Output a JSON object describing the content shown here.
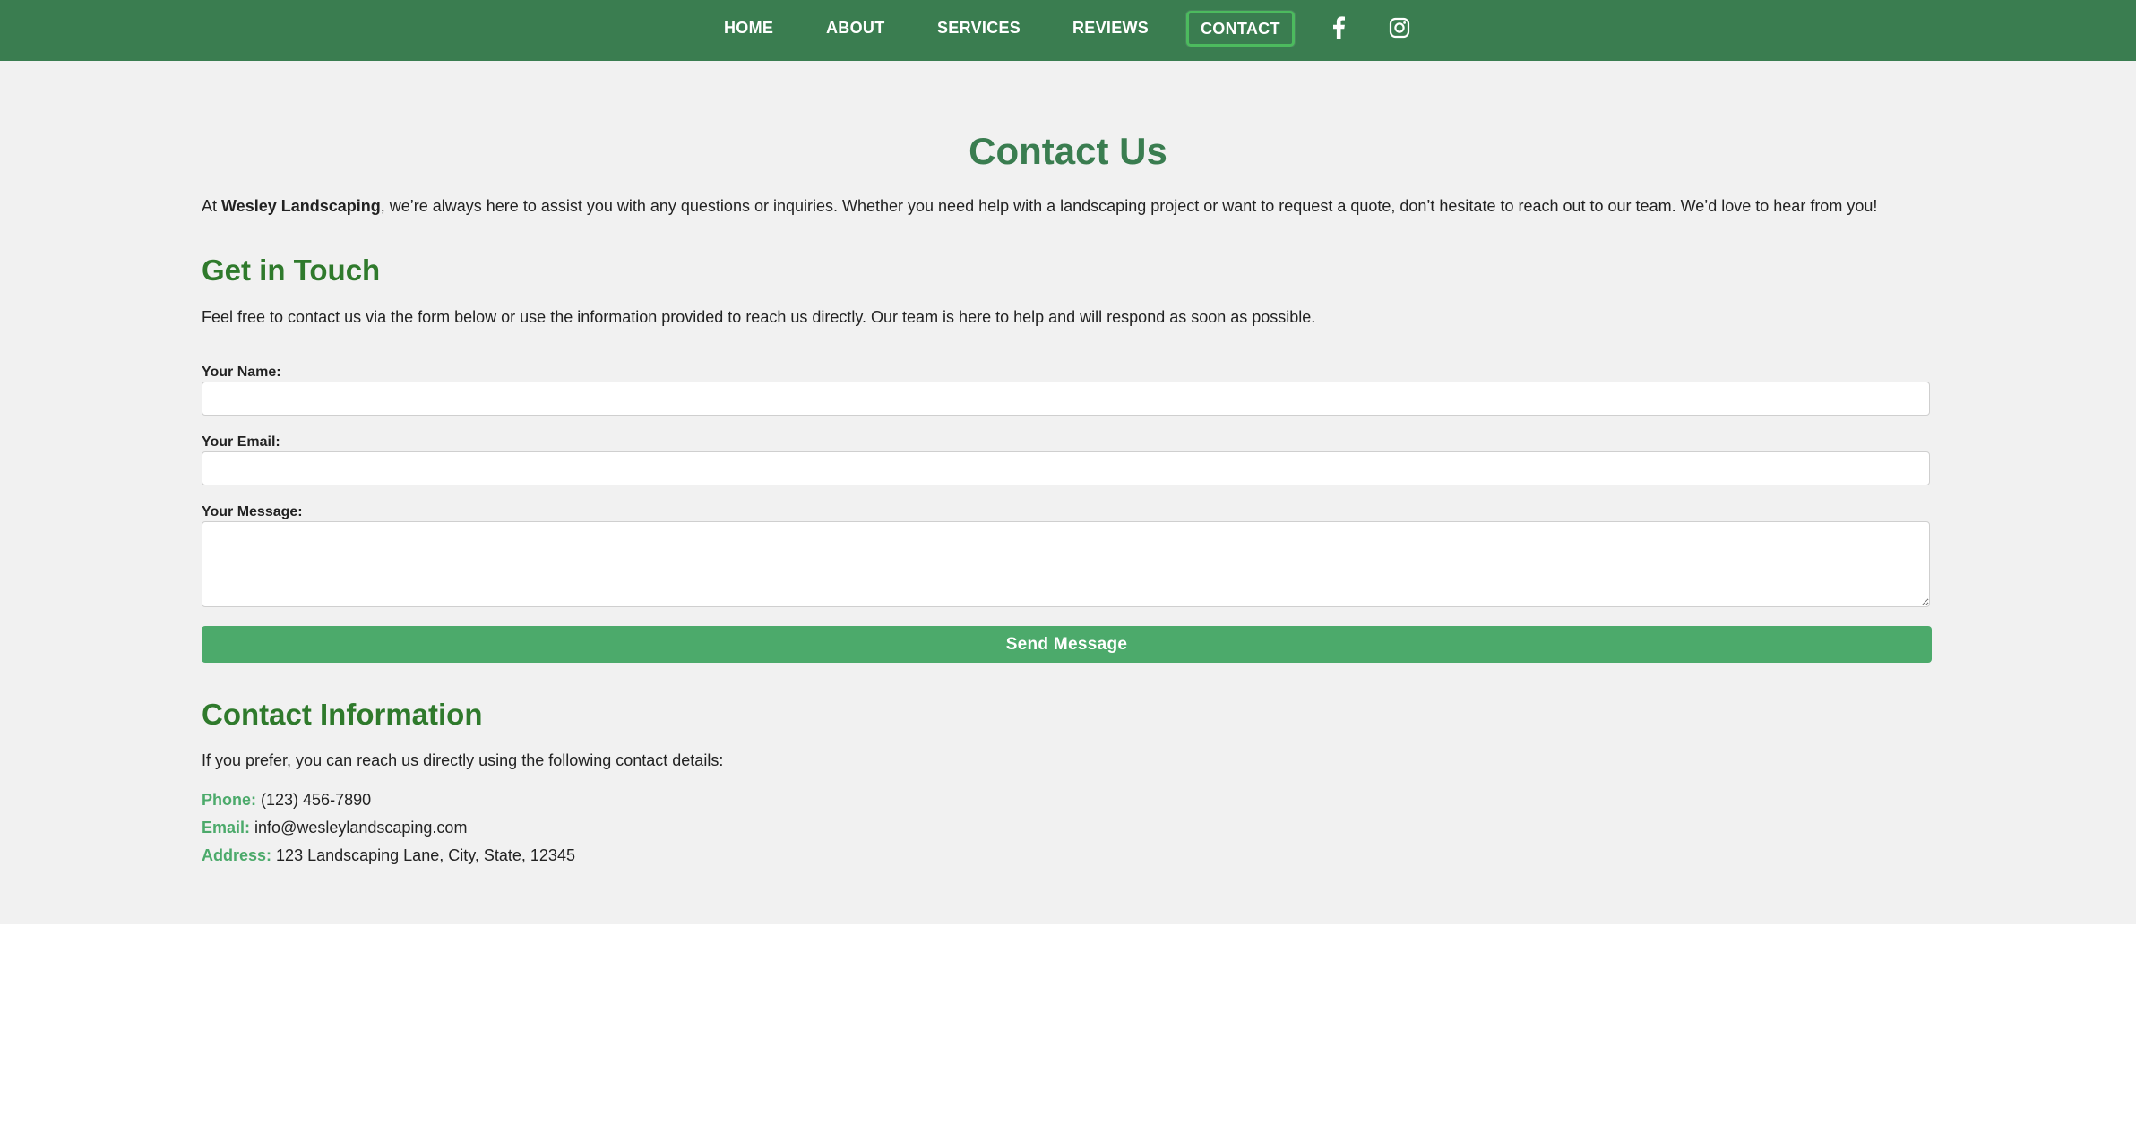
{
  "nav": {
    "items": [
      {
        "label": "HOME"
      },
      {
        "label": "ABOUT"
      },
      {
        "label": "SERVICES"
      },
      {
        "label": "REVIEWS"
      },
      {
        "label": "CONTACT",
        "active": true
      }
    ],
    "social": [
      "facebook-icon",
      "instagram-icon"
    ],
    "background": "#3a7d50",
    "active_border": "#4cbb5e"
  },
  "page": {
    "title": "Contact Us",
    "intro_prefix": "At ",
    "intro_brand": "Wesley Landscaping",
    "intro_suffix": ", we’re always here to assist you with any questions or inquiries. Whether you need help with a landscaping project or want to request a quote, don’t hesitate to reach out to our team. We’d love to hear from you!"
  },
  "get_in_touch": {
    "heading": "Get in Touch",
    "text": "Feel free to contact us via the form below or use the information provided to reach us directly. Our team is here to help and will respond as soon as possible."
  },
  "form": {
    "name_label": "Your Name:",
    "name_value": "",
    "email_label": "Your Email:",
    "email_value": "",
    "message_label": "Your Message:",
    "message_value": "",
    "submit_label": "Send Message",
    "button_color": "#4caa6b"
  },
  "contact_info": {
    "heading": "Contact Information",
    "text": "If you prefer, you can reach us directly using the following contact details:",
    "phone_label": "Phone:",
    "phone_value": "(123) 456-7890",
    "email_label": "Email:",
    "email_value": "info@wesleylandscaping.com",
    "address_label": "Address:",
    "address_value": "123 Landscaping Lane, City, State, 12345"
  },
  "colors": {
    "heading_green": "#3a7d50",
    "subheading_green": "#2f7a2c",
    "content_bg": "#f1f1f1"
  }
}
